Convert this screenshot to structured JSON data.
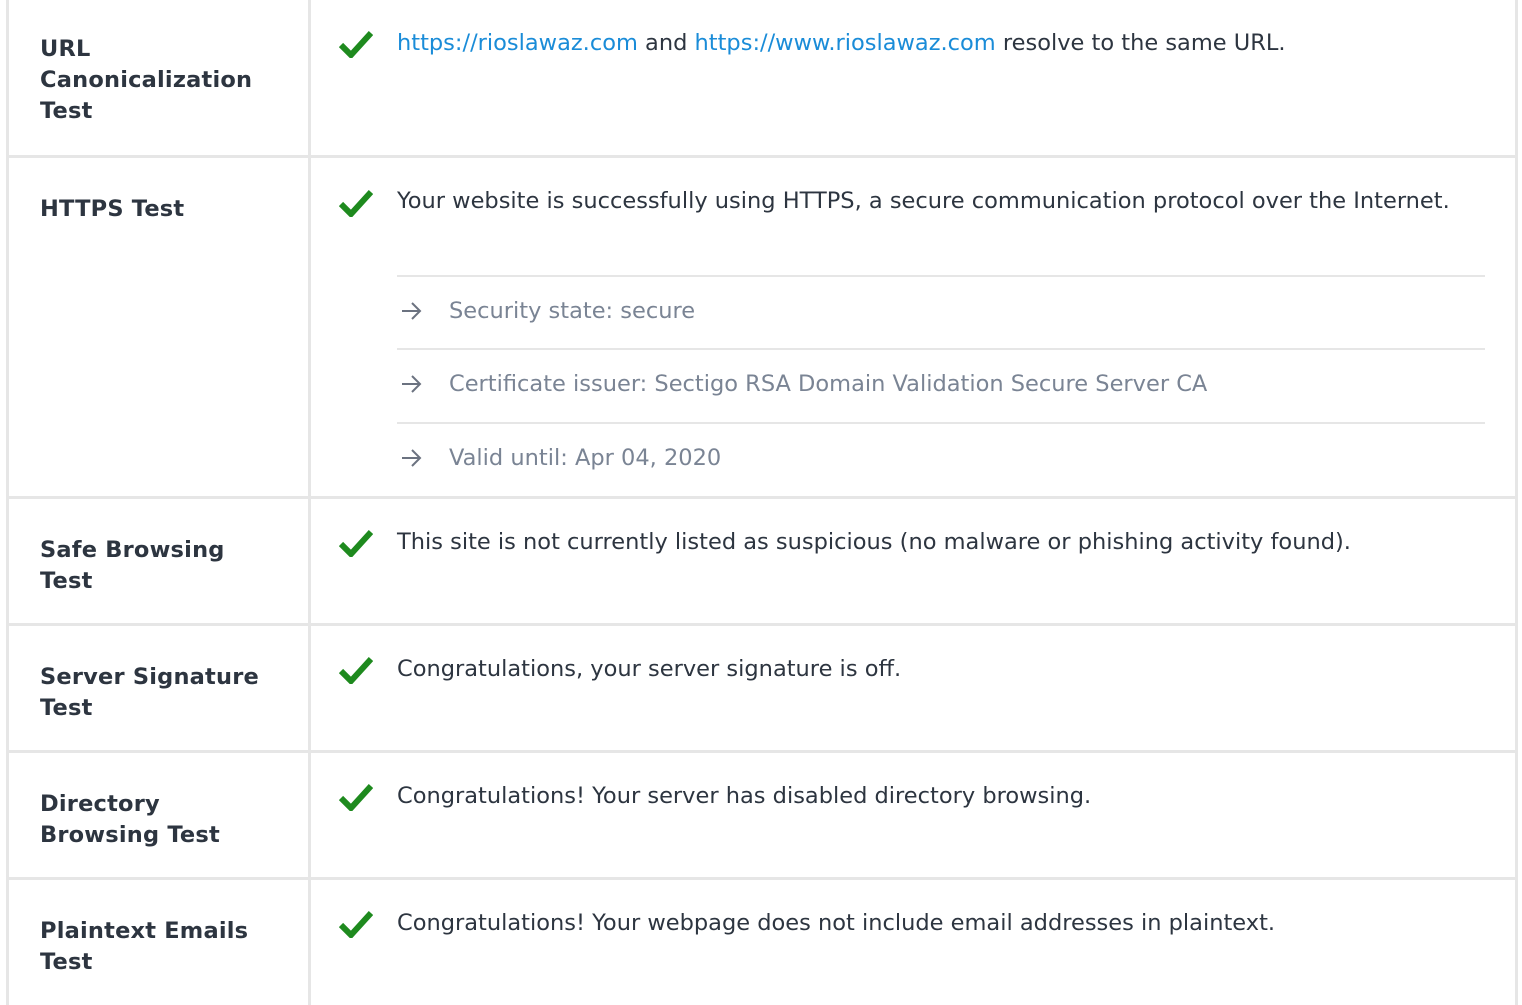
{
  "colors": {
    "check": "#1e8a1e",
    "link": "#1a8cd8",
    "text": "#2d3540",
    "muted": "#7a8494",
    "border": "#e6e6e6"
  },
  "icons": {
    "status": "checkmark-icon",
    "detail": "arrow-right-icon"
  },
  "rows": [
    {
      "label": "URL Canonicalization Test",
      "link1": "https://rioslawaz.com",
      "text_and": " and ",
      "link2": "https://www.rioslawaz.com",
      "text_rest": " resolve to the same URL."
    },
    {
      "label": "HTTPS Test",
      "message": "Your website is successfully using HTTPS, a secure communication protocol over the Internet.",
      "details": [
        "Security state: secure",
        "Certificate issuer: Sectigo RSA Domain Validation Secure Server CA",
        "Valid until: Apr 04, 2020"
      ]
    },
    {
      "label": "Safe Browsing Test",
      "message": "This site is not currently listed as suspicious (no malware or phishing activity found)."
    },
    {
      "label": "Server Signature Test",
      "message": "Congratulations, your server signature is off."
    },
    {
      "label": "Directory Browsing Test",
      "message": "Congratulations! Your server has disabled directory browsing."
    },
    {
      "label": "Plaintext Emails Test",
      "message": "Congratulations! Your webpage does not include email addresses in plaintext."
    }
  ]
}
